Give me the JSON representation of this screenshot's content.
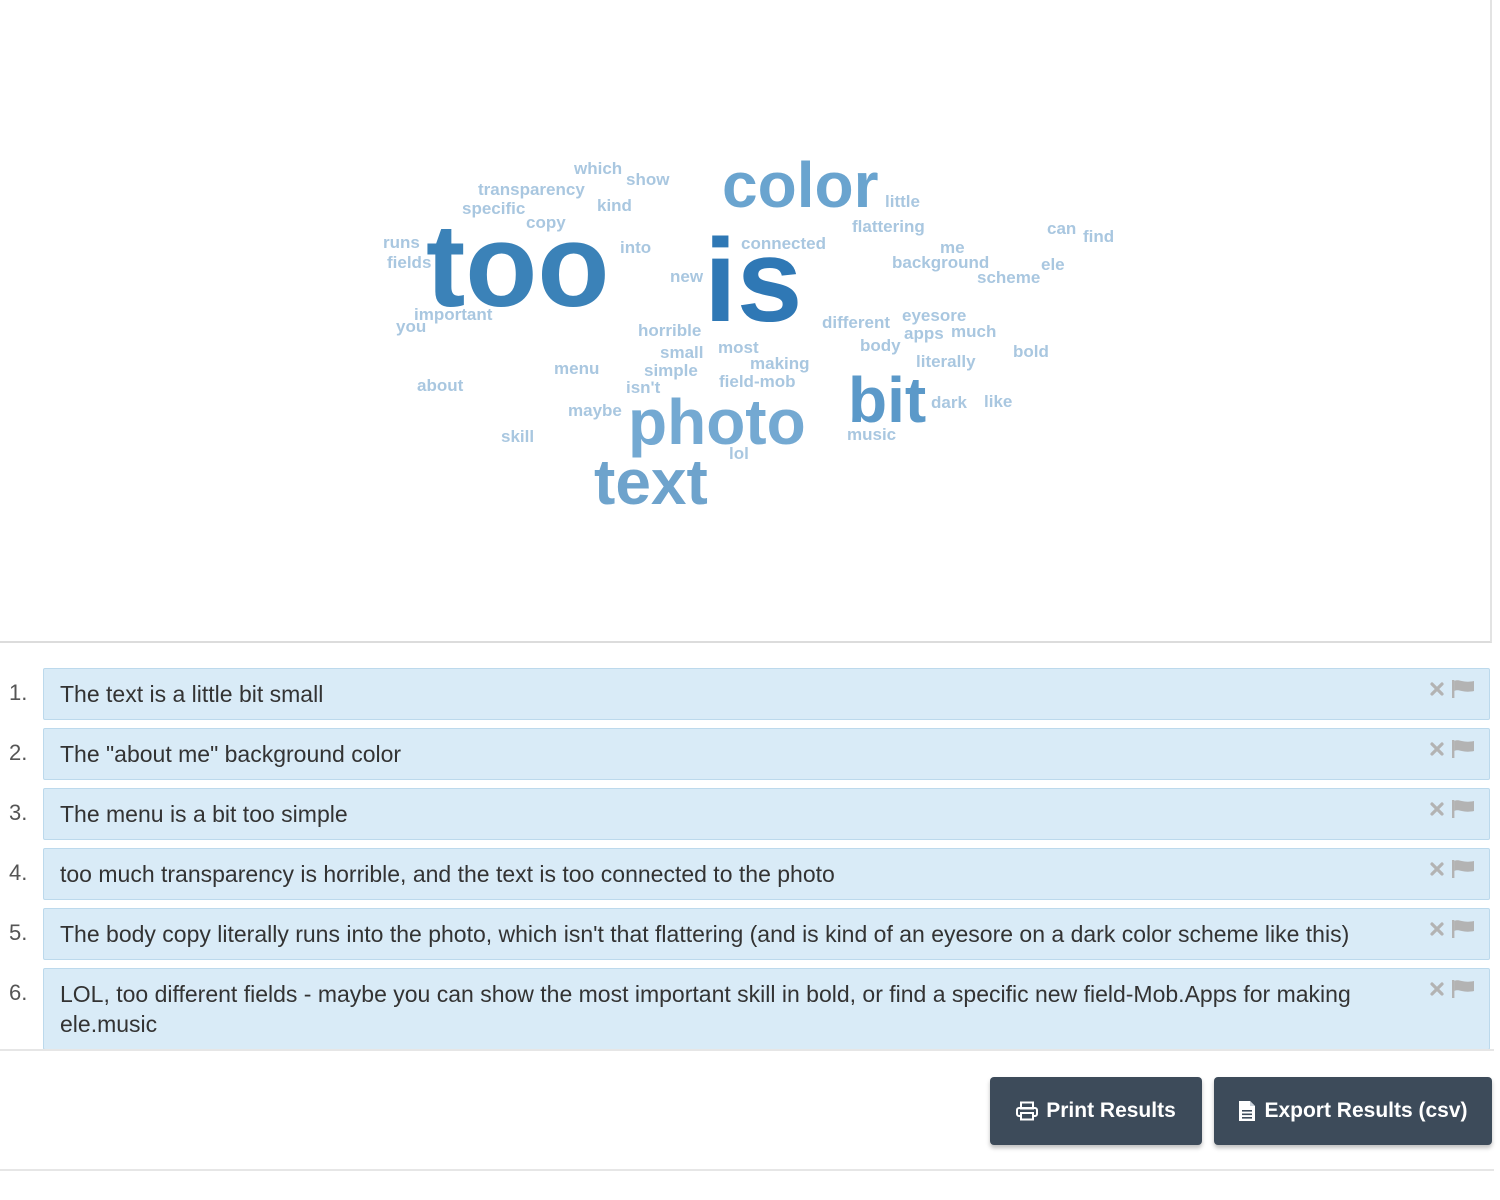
{
  "word_cloud": {
    "words": [
      {
        "text": "too",
        "size": 118,
        "color": "#3b82b8"
      },
      {
        "text": "is",
        "size": 118,
        "color": "#2f78b5"
      },
      {
        "text": "color",
        "size": 64,
        "color": "#6aa4cf"
      },
      {
        "text": "photo",
        "size": 64,
        "color": "#74a9d2"
      },
      {
        "text": "text",
        "size": 64,
        "color": "#6ea3cc"
      },
      {
        "text": "bit",
        "size": 64,
        "color": "#5b99c9"
      },
      {
        "text": "which",
        "size": 17,
        "color": "#a9c7e0"
      },
      {
        "text": "show",
        "size": 17,
        "color": "#a9c7e0"
      },
      {
        "text": "transparency",
        "size": 17,
        "color": "#a9c7e0"
      },
      {
        "text": "specific",
        "size": 17,
        "color": "#a9c7e0"
      },
      {
        "text": "kind",
        "size": 17,
        "color": "#a9c7e0"
      },
      {
        "text": "copy",
        "size": 17,
        "color": "#a9c7e0"
      },
      {
        "text": "runs",
        "size": 17,
        "color": "#a9c7e0"
      },
      {
        "text": "fields",
        "size": 17,
        "color": "#a9c7e0"
      },
      {
        "text": "into",
        "size": 17,
        "color": "#a9c7e0"
      },
      {
        "text": "connected",
        "size": 17,
        "color": "#a9c7e0"
      },
      {
        "text": "little",
        "size": 17,
        "color": "#a9c7e0"
      },
      {
        "text": "flattering",
        "size": 17,
        "color": "#a9c7e0"
      },
      {
        "text": "can",
        "size": 17,
        "color": "#a9c7e0"
      },
      {
        "text": "find",
        "size": 17,
        "color": "#a9c7e0"
      },
      {
        "text": "me",
        "size": 17,
        "color": "#a9c7e0"
      },
      {
        "text": "background",
        "size": 17,
        "color": "#a9c7e0"
      },
      {
        "text": "ele",
        "size": 17,
        "color": "#a9c7e0"
      },
      {
        "text": "scheme",
        "size": 17,
        "color": "#a9c7e0"
      },
      {
        "text": "new",
        "size": 17,
        "color": "#a9c7e0"
      },
      {
        "text": "important",
        "size": 17,
        "color": "#a9c7e0"
      },
      {
        "text": "you",
        "size": 17,
        "color": "#a9c7e0"
      },
      {
        "text": "horrible",
        "size": 17,
        "color": "#a9c7e0"
      },
      {
        "text": "different",
        "size": 17,
        "color": "#a9c7e0"
      },
      {
        "text": "eyesore",
        "size": 17,
        "color": "#a9c7e0"
      },
      {
        "text": "apps",
        "size": 17,
        "color": "#a9c7e0"
      },
      {
        "text": "much",
        "size": 17,
        "color": "#a9c7e0"
      },
      {
        "text": "body",
        "size": 17,
        "color": "#a9c7e0"
      },
      {
        "text": "most",
        "size": 17,
        "color": "#a9c7e0"
      },
      {
        "text": "small",
        "size": 17,
        "color": "#a9c7e0"
      },
      {
        "text": "bold",
        "size": 17,
        "color": "#a9c7e0"
      },
      {
        "text": "menu",
        "size": 17,
        "color": "#a9c7e0"
      },
      {
        "text": "making",
        "size": 17,
        "color": "#a9c7e0"
      },
      {
        "text": "literally",
        "size": 17,
        "color": "#a9c7e0"
      },
      {
        "text": "simple",
        "size": 17,
        "color": "#a9c7e0"
      },
      {
        "text": "field-mob",
        "size": 17,
        "color": "#a9c7e0"
      },
      {
        "text": "isn't",
        "size": 17,
        "color": "#a9c7e0"
      },
      {
        "text": "about",
        "size": 17,
        "color": "#a9c7e0"
      },
      {
        "text": "maybe",
        "size": 17,
        "color": "#a9c7e0"
      },
      {
        "text": "dark",
        "size": 17,
        "color": "#a9c7e0"
      },
      {
        "text": "like",
        "size": 17,
        "color": "#a9c7e0"
      },
      {
        "text": "skill",
        "size": 17,
        "color": "#a9c7e0"
      },
      {
        "text": "music",
        "size": 17,
        "color": "#a9c7e0"
      },
      {
        "text": "lol",
        "size": 17,
        "color": "#a9c7e0"
      }
    ]
  },
  "responses": [
    {
      "number": "1.",
      "text": "The text is a little bit small"
    },
    {
      "number": "2.",
      "text": "The \"about me\" background color"
    },
    {
      "number": "3.",
      "text": "The menu is a bit too simple"
    },
    {
      "number": "4.",
      "text": "too much transparency is horrible, and the text is too connected to the photo"
    },
    {
      "number": "5.",
      "text": "The body copy literally runs into the photo, which isn't that flattering (and is kind of an eyesore on a dark color scheme like this)"
    },
    {
      "number": "6.",
      "text": "LOL, too different fields - maybe you can show the most important skill in bold, or find a specific new field-Mob.Apps for making ele.music"
    }
  ],
  "actions": {
    "print_label": "Print Results",
    "print_icon": "printer-icon",
    "export_label": "Export Results (csv)",
    "export_icon": "document-icon"
  },
  "icons": {
    "delete": "close-icon",
    "flag": "flag-icon"
  },
  "colors": {
    "response_bg": "#d9ebf7",
    "button_bg": "#3d4b5a",
    "icon_gray": "#b3b3b3"
  }
}
